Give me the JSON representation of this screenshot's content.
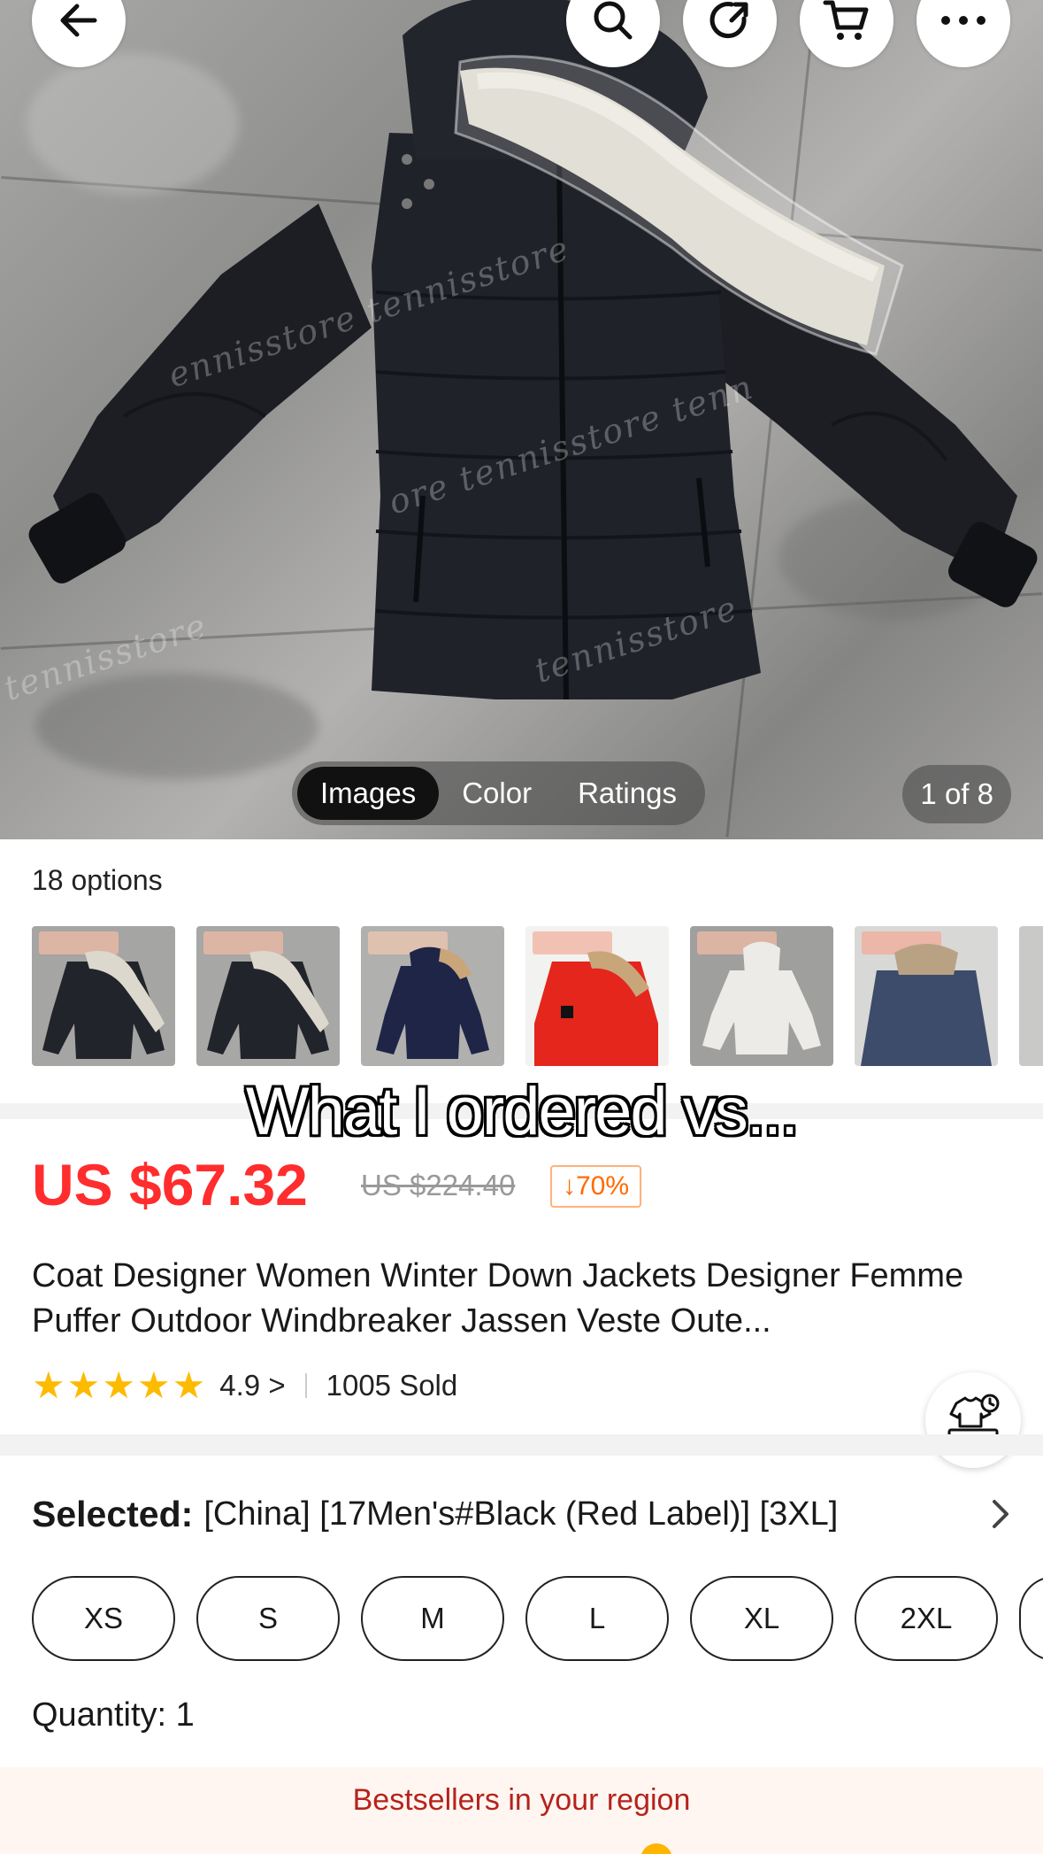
{
  "gallery": {
    "tabs": [
      "Images",
      "Color",
      "Ratings"
    ],
    "active_tab": "Images",
    "counter": "1 of 8"
  },
  "icons": {
    "back": "arrow-left-icon",
    "search": "search-icon",
    "share": "share-icon",
    "cart": "cart-icon",
    "more": "more-icon",
    "assistant": "shopping-assistant-icon",
    "chevron": "chevron-right-icon"
  },
  "options": {
    "label": "18 options"
  },
  "overlay": {
    "caption": "What I ordered vs..."
  },
  "product": {
    "price": "US $67.32",
    "original_price": "US $224.40",
    "discount": "↓70%",
    "title": "Coat Designer Women Winter Down Jackets Designer Femme Puffer Outdoor Windbreaker Jassen Veste Oute...",
    "rating": "4.9 >",
    "rating_value": 4.9,
    "sold": "1005 Sold"
  },
  "selection": {
    "key": "Selected:",
    "value": "[China] [17Men's#Black (Red Label)] [3XL]"
  },
  "sizes": [
    "XS",
    "S",
    "M",
    "L",
    "XL",
    "2XL"
  ],
  "quantity": "Quantity: 1",
  "bestsellers": "Bestsellers in your region",
  "colors": {
    "price_red": "#ff2d2d",
    "discount_orange": "#ff6a00",
    "star_yellow": "#fdbb00",
    "bestsellers_text": "#b5231c"
  }
}
